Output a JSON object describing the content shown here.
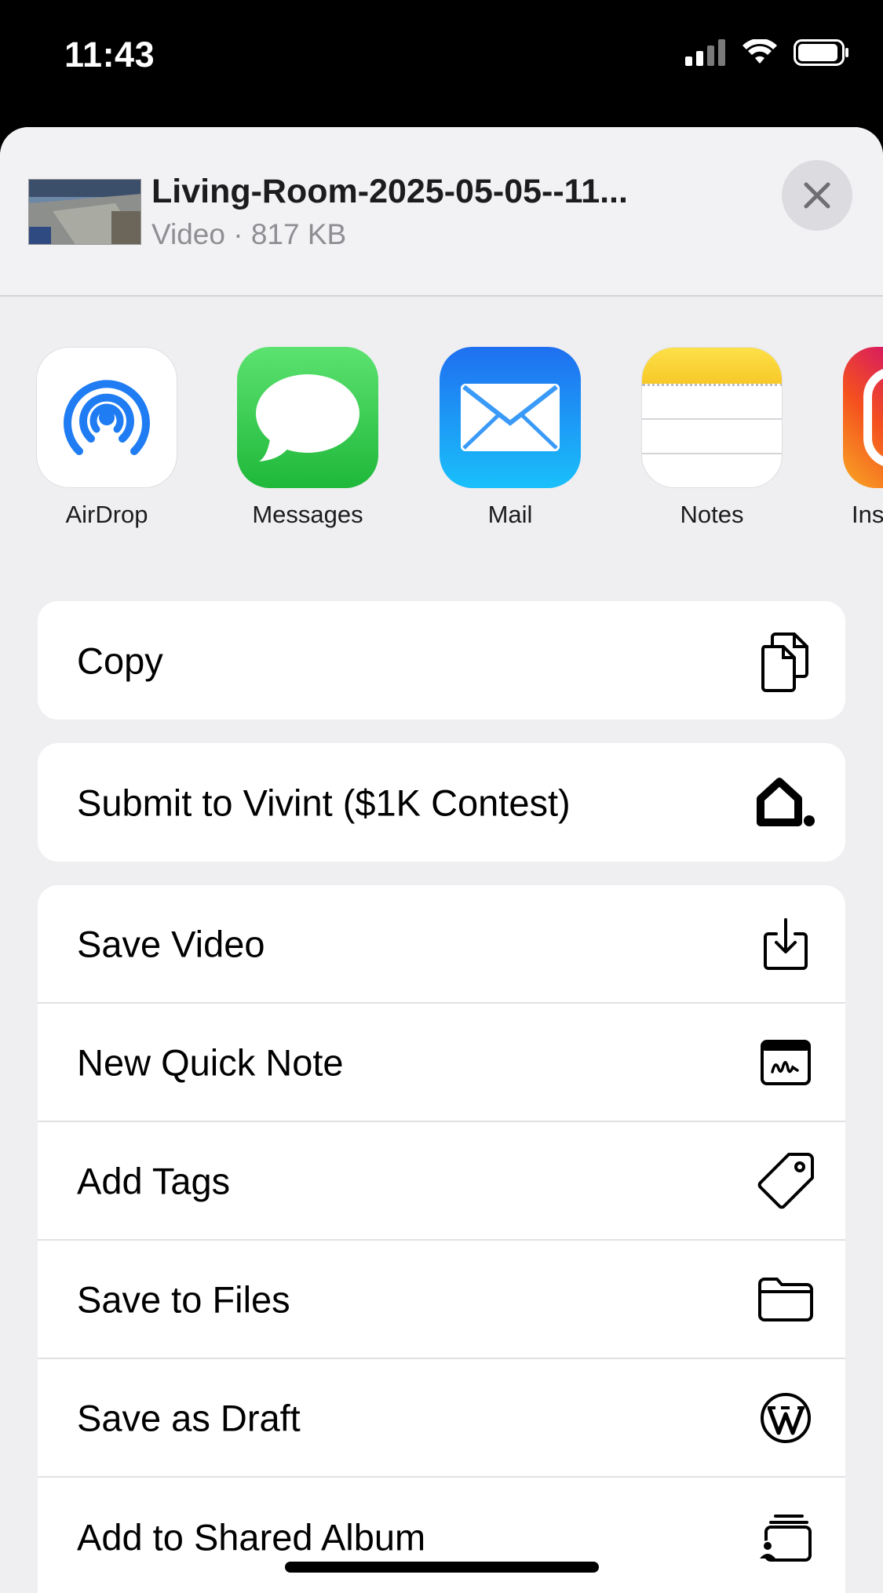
{
  "status_bar": {
    "time": "11:43"
  },
  "header": {
    "file_name": "Living-Room-2025-05-05--11...",
    "file_meta": "Video · 817 KB"
  },
  "apps": [
    {
      "label": "AirDrop",
      "icon": "airdrop-icon"
    },
    {
      "label": "Messages",
      "icon": "messages-icon"
    },
    {
      "label": "Mail",
      "icon": "mail-icon"
    },
    {
      "label": "Notes",
      "icon": "notes-icon"
    },
    {
      "label": "Ins",
      "icon": "instagram-icon"
    }
  ],
  "actions": {
    "copy": "Copy",
    "vivint": "Submit to Vivint ($1K Contest)",
    "save_video": "Save Video",
    "quick_note": "New Quick Note",
    "add_tags": "Add Tags",
    "save_files": "Save to Files",
    "save_draft": "Save as Draft",
    "shared_album": "Add to Shared Album"
  },
  "colors": {
    "airdrop_blue": "#1f7cf2",
    "messages_green": "#2fd150",
    "mail_blue": "#1e8af5",
    "notes_yellow": "#fdd835"
  }
}
